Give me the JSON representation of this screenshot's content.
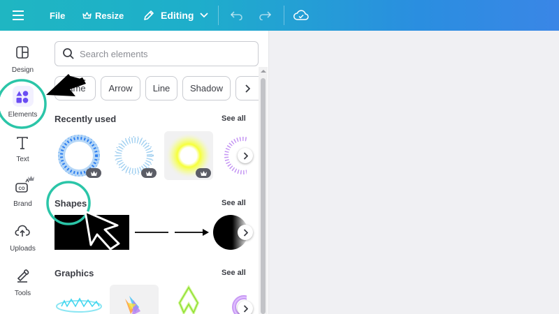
{
  "topbar": {
    "file_label": "File",
    "resize_label": "Resize",
    "editing_label": "Editing"
  },
  "rail": {
    "items": [
      {
        "label": "Design",
        "icon": "layout-icon"
      },
      {
        "label": "Elements",
        "icon": "shapes-icon"
      },
      {
        "label": "Text",
        "icon": "text-icon"
      },
      {
        "label": "Brand",
        "icon": "brand-icon"
      },
      {
        "label": "Uploads",
        "icon": "upload-cloud-icon"
      },
      {
        "label": "Tools",
        "icon": "tools-icon"
      }
    ]
  },
  "panel": {
    "search_placeholder": "Search elements",
    "chips": [
      "Frame",
      "Arrow",
      "Line",
      "Shadow"
    ],
    "sections": [
      {
        "title": "Recently used",
        "see_all": "See all"
      },
      {
        "title": "Shapes",
        "see_all": "See all"
      },
      {
        "title": "Graphics",
        "see_all": "See all"
      }
    ]
  },
  "colors": {
    "accent_teal": "#2bc5a8",
    "brand_purple": "#6a4cf3",
    "topbar_start": "#1fb6c2",
    "topbar_end": "#3a86e6"
  }
}
